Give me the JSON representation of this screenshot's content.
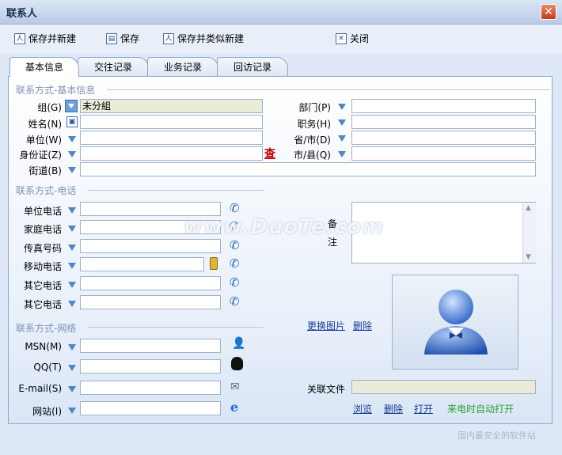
{
  "window": {
    "title": "联系人",
    "close_label": "✕"
  },
  "toolbar": {
    "save_new": "保存并新建",
    "save": "保存",
    "save_copy_new": "保存并类似新建",
    "close": "关闭"
  },
  "tabs": [
    "基本信息",
    "交往记录",
    "业务记录",
    "回访记录"
  ],
  "sections": {
    "basic": "联系方式-基本信息",
    "phone": "联系方式-电话",
    "network": "联系方式-网络"
  },
  "basic": {
    "group_label": "组(G)",
    "group_value": "未分組",
    "name_label": "姓名(N)",
    "unit_label": "单位(W)",
    "id_label": "身份证(Z)",
    "street_label": "街道(B)",
    "check_label": "查",
    "dept_label": "部门(P)",
    "title_label": "职务(H)",
    "province_label": "省/市(D)",
    "city_label": "市/县(Q)"
  },
  "phone": {
    "labels": [
      "单位电话",
      "家庭电话",
      "传真号码",
      "移动电话",
      "其它电话",
      "其它电话"
    ]
  },
  "notes": {
    "label_1": "备",
    "label_2": "注"
  },
  "network": {
    "labels": [
      "MSN(M)",
      "QQ(T)",
      "E-mail(S)",
      "网站(I)"
    ]
  },
  "photo": {
    "change_label": "更换图片",
    "delete_label": "删除"
  },
  "file": {
    "label": "关联文件",
    "browse": "浏览",
    "delete": "删除",
    "open": "打开",
    "auto_open": "来电时自动打开"
  },
  "watermark": {
    "text": "www.DuoTe.com",
    "corner": "国内最安全的软件站"
  }
}
